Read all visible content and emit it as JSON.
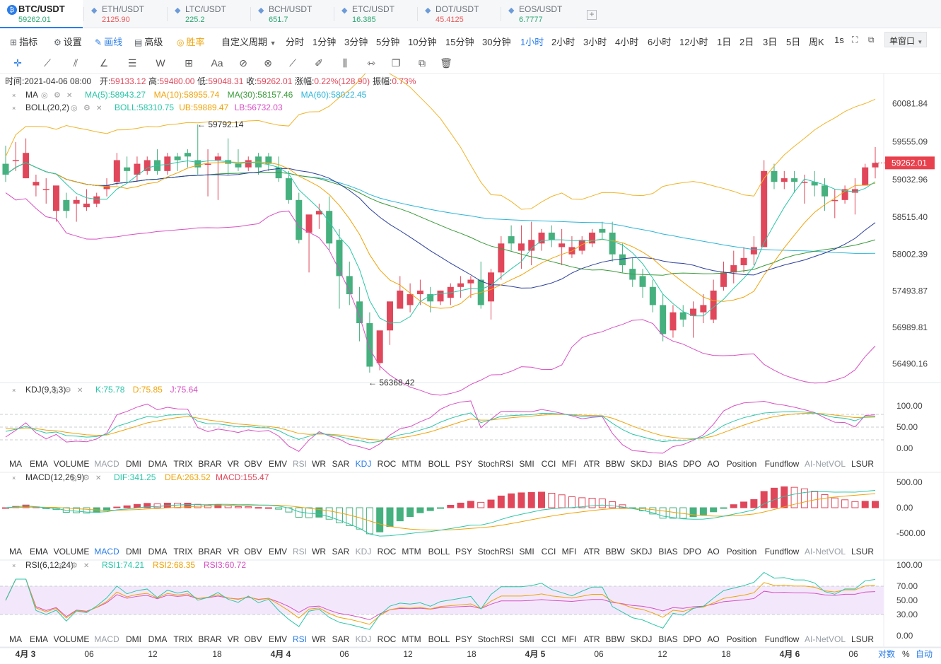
{
  "tabs": [
    {
      "name": "BTC/USDT",
      "price": "59262.01",
      "color": "#2aa872",
      "active": true
    },
    {
      "name": "ETH/USDT",
      "price": "2125.90",
      "color": "#ea5a5a"
    },
    {
      "name": "LTC/USDT",
      "price": "225.2",
      "color": "#2aa872"
    },
    {
      "name": "BCH/USDT",
      "price": "651.7",
      "color": "#2aa872"
    },
    {
      "name": "ETC/USDT",
      "price": "16.385",
      "color": "#2aa872"
    },
    {
      "name": "DOT/USDT",
      "price": "45.4125",
      "color": "#ea5a5a"
    },
    {
      "name": "EOS/USDT",
      "price": "6.7777",
      "color": "#2aa872"
    }
  ],
  "add_tab": "+",
  "toolbar": {
    "indicators": "指标",
    "settings": "设置",
    "draw": "画线",
    "advanced": "高级",
    "winrate": "胜率",
    "custom_period": "自定义周期",
    "periods": [
      "分时",
      "1分钟",
      "3分钟",
      "5分钟",
      "10分钟",
      "15分钟",
      "30分钟",
      "1小时",
      "2小时",
      "3小时",
      "4小时",
      "6小时",
      "12小时",
      "1日",
      "2日",
      "3日",
      "5日",
      "周K",
      "1s"
    ],
    "active_period": "1小时",
    "single_window": "单窗口"
  },
  "ohlc": {
    "time": "时间:2021-04-06 08:00",
    "open": "开:59133.12",
    "high": "高:59480.00",
    "low": "低:59048.31",
    "close": "收:59262.01",
    "change": "涨幅:0.22%(128.90)",
    "amplitude": "振幅:0.73%"
  },
  "ma_legend": {
    "name": "MA",
    "items": [
      "MA(5):58943.27",
      "MA(10):58955.74",
      "MA(30):58157.46",
      "MA(60):58022.45"
    ]
  },
  "boll_legend": {
    "name": "BOLL(20,2)",
    "items": [
      "BOLL:58310.75",
      "UB:59889.47",
      "LB:56732.03"
    ]
  },
  "kdj_legend": {
    "name": "KDJ(9,3,3)",
    "items": [
      "K:75.78",
      "D:75.85",
      "J:75.64"
    ]
  },
  "macd_legend": {
    "name": "MACD(12,26,9)",
    "items": [
      "DIF:341.25",
      "DEA:263.52",
      "MACD:155.47"
    ]
  },
  "rsi_legend": {
    "name": "RSI(6,12,24)",
    "items": [
      "RSI1:74.21",
      "RSI2:68.35",
      "RSI3:60.72"
    ]
  },
  "indicator_tabs": [
    "MA",
    "EMA",
    "VOLUME",
    "MACD",
    "DMI",
    "DMA",
    "TRIX",
    "BRAR",
    "VR",
    "OBV",
    "EMV",
    "RSI",
    "WR",
    "SAR",
    "KDJ",
    "ROC",
    "MTM",
    "BOLL",
    "PSY",
    "StochRSI",
    "SMI",
    "CCI",
    "MFI",
    "ATR",
    "BBW",
    "SKDJ",
    "BIAS",
    "DPO",
    "AO",
    "Position",
    "Fundflow",
    "AI-NetVOL",
    "LSUR"
  ],
  "price_axis": [
    "60081.84",
    "59555.09",
    "59032.96",
    "58515.40",
    "58002.39",
    "57493.87",
    "56989.81",
    "56490.16"
  ],
  "last_price": "59262.01",
  "high_marker": "← 59792.14",
  "low_marker": "← 56368.42",
  "kdj_axis": [
    "100.00",
    "50.00",
    "0.00"
  ],
  "macd_axis": [
    "500.00",
    "0.00",
    "-500.00"
  ],
  "rsi_axis": [
    "100.00",
    "70.00",
    "50.00",
    "30.00",
    "0.00"
  ],
  "time_axis": [
    "4月 3",
    "06",
    "12",
    "18",
    "4月 4",
    "06",
    "12",
    "18",
    "4月 5",
    "06",
    "12",
    "18",
    "4月 6",
    "06"
  ],
  "bottom_right": {
    "log": "对数",
    "pct": "%",
    "auto": "自动"
  },
  "colors": {
    "up": "#e0475a",
    "down": "#46b07e",
    "accent": "#2b7de9"
  },
  "chart_data": {
    "type": "candlestick",
    "interval": "1小时",
    "candles": [
      [
        59250,
        59500,
        59100,
        59000
      ],
      [
        59300,
        59550,
        59300,
        59150
      ],
      [
        59050,
        59600,
        59400,
        59050
      ],
      [
        58950,
        59100,
        59000,
        58800
      ],
      [
        58900,
        59050,
        58900,
        58700
      ],
      [
        58600,
        58800,
        58950,
        58450
      ],
      [
        58750,
        58850,
        58600,
        58500
      ],
      [
        58700,
        58800,
        58750,
        58450
      ],
      [
        58650,
        58900,
        58700,
        58600
      ],
      [
        58700,
        58850,
        58800,
        58650
      ],
      [
        58900,
        59050,
        58950,
        58800
      ],
      [
        59000,
        59400,
        59300,
        58950
      ],
      [
        59200,
        59350,
        59150,
        59000
      ],
      [
        59100,
        59350,
        59250,
        59000
      ],
      [
        59150,
        59350,
        59300,
        59100
      ],
      [
        59300,
        59450,
        59150,
        59100
      ],
      [
        59150,
        59400,
        59350,
        59100
      ],
      [
        59350,
        59400,
        59300,
        59150
      ],
      [
        59400,
        59450,
        59350,
        59200
      ],
      [
        59300,
        59792,
        59200,
        59100
      ],
      [
        59250,
        59450,
        59250,
        58800
      ],
      [
        59300,
        59400,
        59350,
        58750
      ],
      [
        59300,
        59600,
        59250,
        59100
      ],
      [
        59250,
        59450,
        59200,
        59150
      ],
      [
        59200,
        59350,
        59300,
        59150
      ],
      [
        59350,
        59400,
        59200,
        59100
      ],
      [
        59350,
        59400,
        59250,
        59150
      ],
      [
        59200,
        59350,
        59050,
        59000
      ],
      [
        59050,
        59150,
        58750,
        58700
      ],
      [
        58750,
        58850,
        58200,
        58150
      ],
      [
        58300,
        58350,
        58550,
        57750
      ],
      [
        58550,
        58700,
        58600,
        58350
      ],
      [
        58600,
        58800,
        58150,
        58050
      ],
      [
        58200,
        58350,
        57700,
        57250
      ],
      [
        57700,
        57900,
        57450,
        57300
      ],
      [
        57350,
        57550,
        57050,
        56800
      ],
      [
        57050,
        57200,
        56450,
        56368
      ],
      [
        56500,
        56900,
        56950,
        56400
      ],
      [
        56950,
        57300,
        57350,
        56750
      ],
      [
        57250,
        57700,
        57500,
        57300
      ],
      [
        57300,
        57600,
        57450,
        57200
      ],
      [
        57450,
        57650,
        57500,
        57300
      ],
      [
        57450,
        57550,
        57350,
        57200
      ],
      [
        57350,
        57500,
        57500,
        57300
      ],
      [
        57400,
        57600,
        57550,
        57300
      ],
      [
        57550,
        57700,
        57600,
        57400
      ],
      [
        57600,
        57700,
        57650,
        57400
      ],
      [
        57650,
        57900,
        57300,
        57250
      ],
      [
        57350,
        57800,
        57750,
        57100
      ],
      [
        57750,
        58250,
        58150,
        57650
      ],
      [
        58250,
        58400,
        58150,
        58050
      ],
      [
        58050,
        58400,
        58150,
        57800
      ],
      [
        58050,
        58450,
        58200,
        57850
      ],
      [
        58150,
        58350,
        58300,
        58050
      ],
      [
        58300,
        58400,
        58200,
        58100
      ],
      [
        58100,
        58350,
        58150,
        57850
      ],
      [
        58000,
        58250,
        58100,
        57950
      ],
      [
        58050,
        58250,
        58200,
        58000
      ],
      [
        58150,
        58350,
        58300,
        58100
      ],
      [
        58350,
        58450,
        58300,
        58200
      ],
      [
        58300,
        58450,
        58000,
        57900
      ],
      [
        58000,
        58150,
        57850,
        57750
      ],
      [
        57800,
        57950,
        57650,
        57550
      ],
      [
        57700,
        57800,
        57550,
        57400
      ],
      [
        57550,
        57650,
        57300,
        57200
      ],
      [
        57300,
        57450,
        56900,
        56800
      ],
      [
        56950,
        57300,
        57200,
        56850
      ],
      [
        57200,
        57300,
        57100,
        57000
      ],
      [
        57150,
        57350,
        57250,
        56850
      ],
      [
        57200,
        57450,
        57300,
        57050
      ],
      [
        57100,
        57650,
        57500,
        57050
      ],
      [
        57550,
        57900,
        57750,
        57500
      ],
      [
        57750,
        58050,
        57850,
        57600
      ],
      [
        57850,
        58100,
        57950,
        57750
      ],
      [
        58000,
        58250,
        58100,
        57850
      ],
      [
        58100,
        59300,
        59150,
        58100
      ],
      [
        59150,
        59250,
        59000,
        58900
      ],
      [
        59000,
        59150,
        59050,
        58900
      ],
      [
        59050,
        59150,
        59000,
        58850
      ],
      [
        59000,
        59100,
        59000,
        58700
      ],
      [
        59000,
        59150,
        58950,
        58800
      ],
      [
        58950,
        59050,
        58800,
        58600
      ],
      [
        58750,
        58900,
        58750,
        58500
      ],
      [
        58750,
        58950,
        58900,
        58700
      ],
      [
        58850,
        59050,
        58900,
        58550
      ],
      [
        58950,
        59250,
        59200,
        58950
      ],
      [
        59200,
        59480,
        59262,
        59048
      ]
    ]
  }
}
